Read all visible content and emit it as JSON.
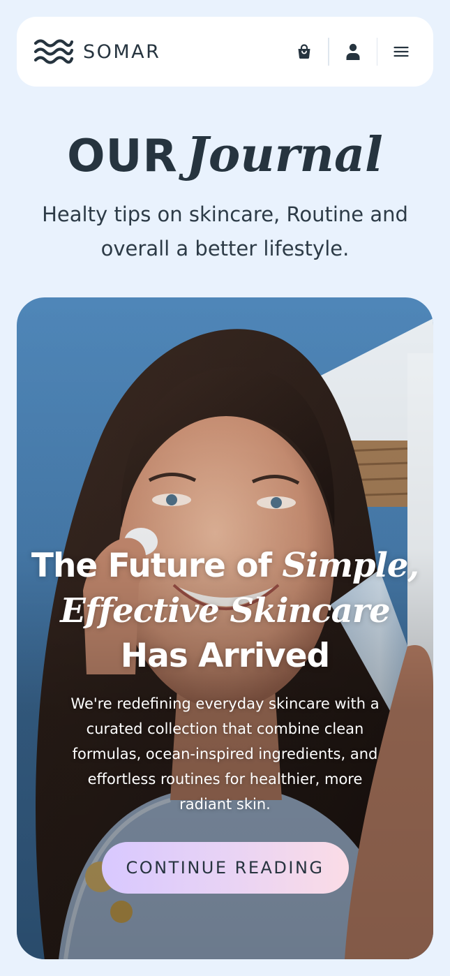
{
  "header": {
    "brand_name": "SOMAR",
    "cart_icon": "shopping-bag-icon",
    "account_icon": "user-icon",
    "menu_icon": "hamburger-menu-icon"
  },
  "hero": {
    "title_caps": "OUR",
    "title_script": "Journal",
    "subtitle": "Healty tips on skincare, Routine and overall a better lifestyle."
  },
  "featured": {
    "headline_part1": "The Future of ",
    "headline_italic": "Simple, Effective Skincare",
    "headline_part2": "Has Arrived",
    "body": "We're redefining everyday skincare with a curated collection that combine clean formulas, ocean-inspired ingredients, and effortless routines for healthier, more radiant skin.",
    "cta_label": "CONTINUE READING"
  },
  "colors": {
    "page_background": "#e9f2fd",
    "header_background": "#ffffff",
    "text_dark": "#26343f",
    "cta_gradient_start": "#d8c8ff",
    "cta_gradient_end": "#fbdce6"
  }
}
